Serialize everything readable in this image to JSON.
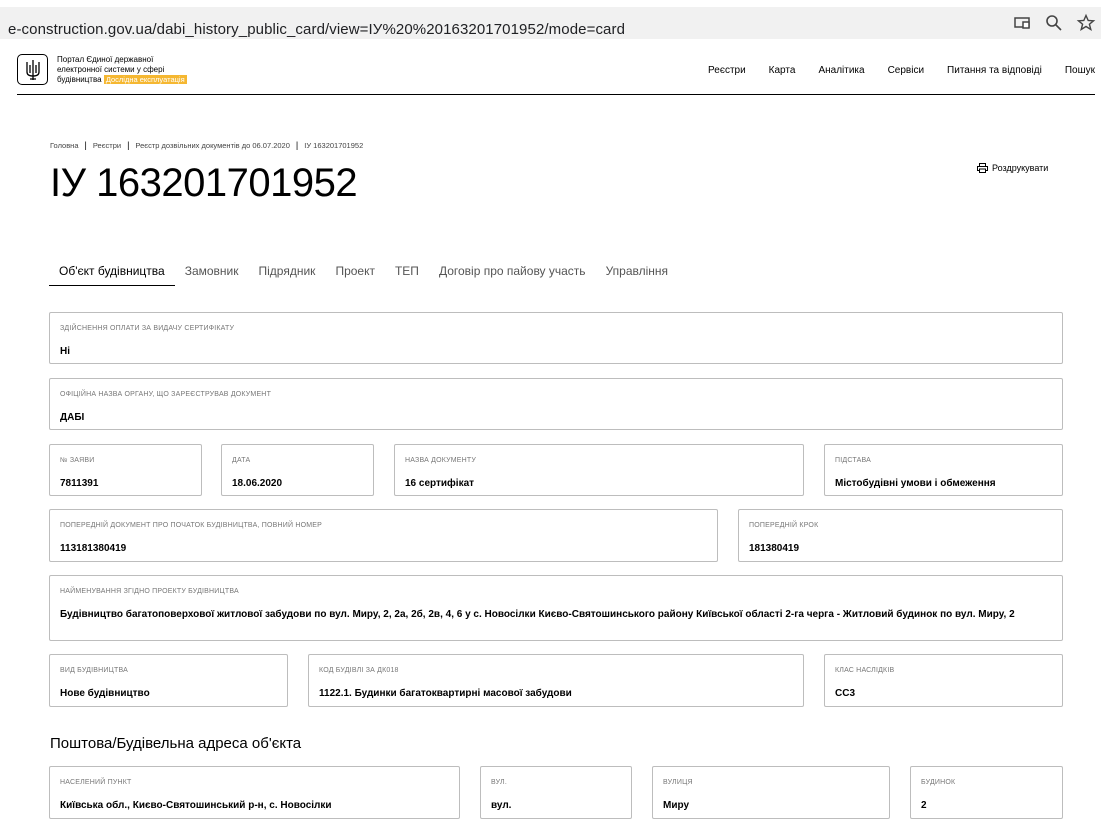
{
  "browser": {
    "url": "e-construction.gov.ua/dabi_history_public_card/view=ІУ%20%20163201701952/mode=card"
  },
  "header": {
    "portal_line1": "Портал Єдиної державної",
    "portal_line2": "електронної системи у сфері",
    "portal_line3": "будівництва",
    "badge": "Дослідна експлуатація",
    "nav": [
      "Реєстри",
      "Карта",
      "Аналітика",
      "Сервіси",
      "Питання та відповіді",
      "Пошук"
    ]
  },
  "breadcrumb": [
    "Головна",
    "Реєстри",
    "Реєстр дозвільних документів до 06.07.2020",
    "ІУ 163201701952"
  ],
  "title": "ІУ 163201701952",
  "print_label": "Роздрукувати",
  "tabs": [
    "Об'єкт будівництва",
    "Замовник",
    "Підрядник",
    "Проект",
    "ТЕП",
    "Договір про пайову участь",
    "Управління"
  ],
  "fields": {
    "payment": {
      "label": "Здійснення оплати за видачу сертифікату",
      "value": "Ні"
    },
    "authority": {
      "label": "Офіційна назва органу, що зареєстрував документ",
      "value": "ДАБІ"
    },
    "app_no": {
      "label": "№ заяви",
      "value": "7811391"
    },
    "date": {
      "label": "Дата",
      "value": "18.06.2020"
    },
    "doc_name": {
      "label": "Назва документу",
      "value": "16 сертифікат"
    },
    "basis": {
      "label": "Підстава",
      "value": "Містобудівні умови і обмеження"
    },
    "prev_doc": {
      "label": "Попередній документ про початок будівництва, повний номер",
      "value": "113181380419"
    },
    "prev_step": {
      "label": "Попередній крок",
      "value": "181380419"
    },
    "name": {
      "label": "Найменування згідно проекту будівництва",
      "value": "Будівництво багатоповерхової житлової забудови по вул. Миру, 2, 2а, 2б, 2в, 4, 6 у с. Новосілки Києво-Святошинського району Київської області 2-га черга - Житловий будинок по вул. Миру, 2"
    },
    "kind": {
      "label": "Вид будівництва",
      "value": "Нове будівництво"
    },
    "code": {
      "label": "Код будівлі за ДК018",
      "value": "1122.1. Будинки багатоквартирні масової забудови"
    },
    "class": {
      "label": "Клас наслідків",
      "value": "СС3"
    }
  },
  "address": {
    "title": "Поштова/Будівельна адреса об'єкта",
    "settlement": {
      "label": "Населений пункт",
      "value": "Київська обл., Києво-Святошинський р-н, с. Новосілки"
    },
    "street_type": {
      "label": "Вул.",
      "value": "вул."
    },
    "street": {
      "label": "Вулиця",
      "value": "Миру"
    },
    "house": {
      "label": "Будинок",
      "value": "2"
    }
  }
}
